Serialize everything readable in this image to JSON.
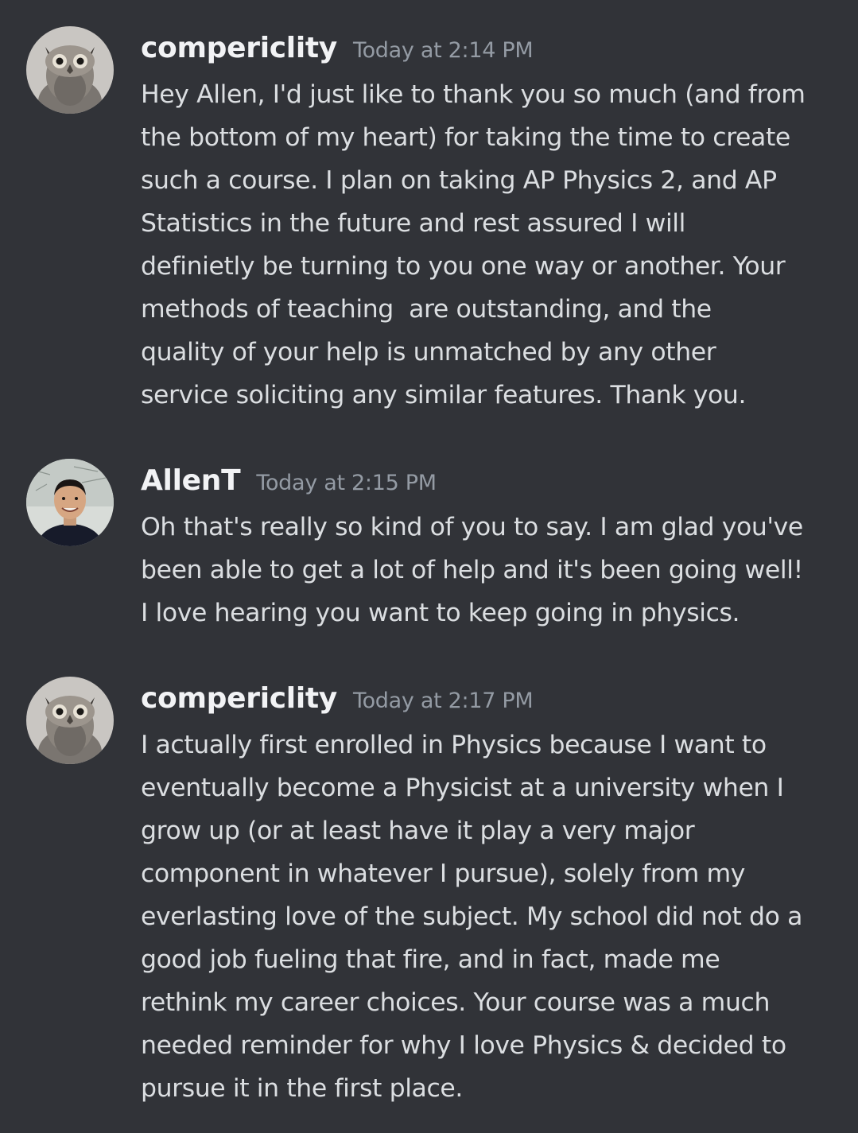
{
  "messages": [
    {
      "author": "compericlity",
      "timestamp": "Today at 2:14 PM",
      "avatar_icon": "owl-avatar-icon",
      "lines": [
        "Hey Allen, I'd just like to thank you so much (and from",
        "the bottom of my heart) for taking the time to create",
        "such a course. I plan on taking AP Physics 2, and AP",
        "Statistics in the future and rest assured I will",
        "definietly be turning to you one way or another. Your",
        "methods of teaching  are outstanding, and the",
        "quality of your help is unmatched by any other",
        "service soliciting any similar features. Thank you."
      ]
    },
    {
      "author": "AllenT",
      "timestamp": "Today at 2:15 PM",
      "avatar_icon": "person-avatar-icon",
      "lines": [
        "Oh that's really so kind of you to say. I am glad you've",
        "been able to get a lot of help and it's been going well!",
        "I love hearing you want to keep going in physics."
      ]
    },
    {
      "author": "compericlity",
      "timestamp": "Today at 2:17 PM",
      "avatar_icon": "owl-avatar-icon",
      "lines": [
        "I actually first enrolled in Physics because I want to",
        "eventually become a Physicist at a university when I",
        "grow up (or at least have it play a very major",
        "component in whatever I pursue), solely from my",
        "everlasting love of the subject. My school did not do a",
        "good job fueling that fire, and in fact, made me",
        "rethink my career choices. Your course was a much",
        "needed reminder for why I love Physics & decided to",
        "pursue it in the first place."
      ]
    }
  ],
  "colors": {
    "background": "#313338",
    "username": "#f2f3f5",
    "timestamp": "#949ba4",
    "message_text": "#dbdee1"
  }
}
